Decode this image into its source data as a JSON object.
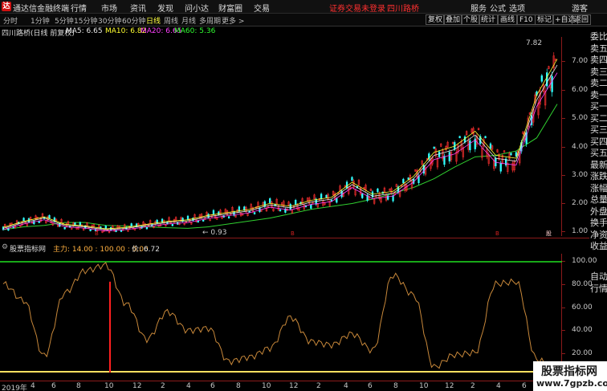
{
  "app": {
    "logo": "达",
    "title": "通达信金融终端",
    "menu": [
      "行情",
      "市场",
      "资讯",
      "发现",
      "问小达",
      "财富圈",
      "交易"
    ],
    "notice": "证券交易未登录",
    "stock_link": "四川路桥",
    "window_buttons": [
      "□",
      "▭",
      "✕"
    ]
  },
  "period_bar": {
    "periods": [
      "分时",
      "1分钟",
      "5分钟",
      "15分钟",
      "30分钟",
      "60分钟",
      "日线",
      "周线",
      "月线",
      "多周期",
      "更多 >"
    ],
    "selected": "日线",
    "tools": [
      "复权",
      "叠加",
      "个股",
      "统计",
      "画线",
      "F10",
      "标记",
      "+自选",
      "返回"
    ]
  },
  "main_chart": {
    "stock": "四川路桥(日线 前复权)",
    "ma": [
      {
        "label": "MA5: 6.65",
        "color": "#e8e8e8"
      },
      {
        "label": "MA10: 6.82",
        "color": "#ffff30"
      },
      {
        "label": "MA20: 6.65",
        "color": "#ff40ff"
      },
      {
        "label": "MA60: 5.36",
        "color": "#30ff30"
      }
    ],
    "high_label": "7.82",
    "low_label": "← 0.93",
    "y_ticks": [
      "7.00",
      "6.00",
      "5.00",
      "4.00",
      "3.00",
      "2.00",
      "1.00"
    ],
    "markers": [
      "B",
      "B",
      "B",
      "股"
    ]
  },
  "right_panel": {
    "items": [
      "委比",
      "卖五",
      "卖四",
      "卖三",
      "卖二",
      "卖一",
      "买一",
      "买二",
      "买三",
      "买四",
      "买五",
      "最新",
      "涨跌",
      "涨幅",
      "总量",
      "外盘",
      "换手",
      "净资",
      "收益"
    ],
    "tabs": [
      "自动",
      "行情"
    ]
  },
  "indicator": {
    "name": "股票指标网",
    "params": "主力: 14.00 : 100.00 : 0.00",
    "price": "价: 6.72",
    "y_ticks": [
      "100.00",
      "80.00",
      "60.00",
      "40.00",
      "20.00"
    ]
  },
  "x_axis": [
    "2019年",
    "4",
    "6",
    "8",
    "10",
    "12",
    "2",
    "4",
    "6",
    "8",
    "10",
    "12",
    "2",
    "4",
    "6",
    "8",
    "10",
    "12",
    "2",
    "4",
    "6",
    "8"
  ],
  "watermark": {
    "line1": "股票指标网",
    "line2": "www.7gpzb.com"
  },
  "chart_data": {
    "type": "line",
    "price_ylim": [
      0.93,
      7.82
    ],
    "indicator_ylim": [
      0,
      100
    ],
    "x": [
      "2019-02",
      "2019-04",
      "2019-06",
      "2019-08",
      "2019-10",
      "2019-12",
      "2020-02",
      "2020-04",
      "2020-06",
      "2020-08",
      "2020-10",
      "2020-12",
      "2021-02",
      "2021-04",
      "2021-06",
      "2021-08",
      "2021-10",
      "2021-12",
      "2022-02",
      "2022-04",
      "2022-06",
      "2022-08",
      "2022-10",
      "2022-12",
      "2023-02",
      "2023-04",
      "2023-06",
      "2023-08"
    ],
    "series": [
      {
        "name": "MA60",
        "values": [
          1.05,
          1.15,
          1.2,
          1.3,
          1.3,
          1.2,
          1.18,
          1.15,
          1.12,
          1.1,
          1.15,
          1.25,
          1.35,
          1.45,
          1.6,
          1.75,
          1.85,
          1.95,
          2.1,
          2.3,
          2.5,
          2.8,
          3.2,
          3.55,
          3.6,
          3.75,
          4.2,
          5.36
        ]
      },
      {
        "name": "主力",
        "values": [
          80,
          65,
          15,
          72,
          92,
          97,
          62,
          30,
          55,
          38,
          40,
          10,
          14,
          22,
          50,
          28,
          25,
          35,
          20,
          88,
          70,
          5,
          16,
          18,
          80,
          82,
          12,
          0
        ]
      }
    ]
  }
}
